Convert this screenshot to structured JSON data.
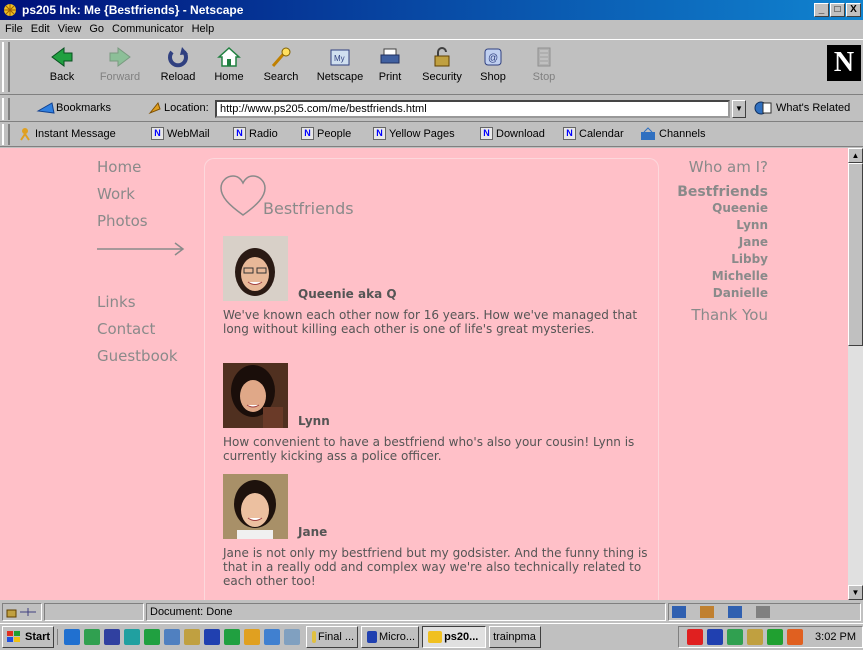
{
  "window": {
    "title": "ps205 Ink: Me {Bestfriends} - Netscape",
    "min": "_",
    "max": "□",
    "close": "X"
  },
  "menu": [
    "File",
    "Edit",
    "View",
    "Go",
    "Communicator",
    "Help"
  ],
  "toolbar": {
    "back": "Back",
    "forward": "Forward",
    "reload": "Reload",
    "home": "Home",
    "search": "Search",
    "netscape": "Netscape",
    "print": "Print",
    "security": "Security",
    "shop": "Shop",
    "stop": "Stop"
  },
  "location": {
    "bookmarks": "Bookmarks",
    "label": "Location:",
    "url": "http://www.ps205.com/me/bestfriends.html",
    "whats_related": "What's Related"
  },
  "personal": [
    "Instant Message",
    "WebMail",
    "Radio",
    "People",
    "Yellow Pages",
    "Download",
    "Calendar",
    "Channels"
  ],
  "page": {
    "left_nav": [
      "Home",
      "Work",
      "Photos",
      "Links",
      "Contact",
      "Guestbook"
    ],
    "heading": "Bestfriends",
    "friends": [
      {
        "name": "Queenie aka Q",
        "desc": "We've known each other now for 16 years. How we've managed that long without killing each other is one of life's great mysteries."
      },
      {
        "name": "Lynn",
        "desc": "How convenient to have a bestfriend who's also your cousin! Lynn is currently kicking ass a police officer."
      },
      {
        "name": "Jane",
        "desc": "Jane is not only my bestfriend but my godsister. And the funny thing is that in a really odd and complex way we're also technically related to each other too!"
      }
    ],
    "right_nav": {
      "who": "Who am I?",
      "current": "Bestfriends",
      "subs": [
        "Queenie",
        "Lynn",
        "Jane",
        "Libby",
        "Michelle",
        "Danielle"
      ],
      "thanks": "Thank You"
    }
  },
  "status": {
    "text": "Document: Done"
  },
  "taskbar": {
    "start": "Start",
    "tasks": [
      "Final ...",
      "Micro...",
      "ps20...",
      "trainpma"
    ],
    "clock": "3:02 PM"
  }
}
